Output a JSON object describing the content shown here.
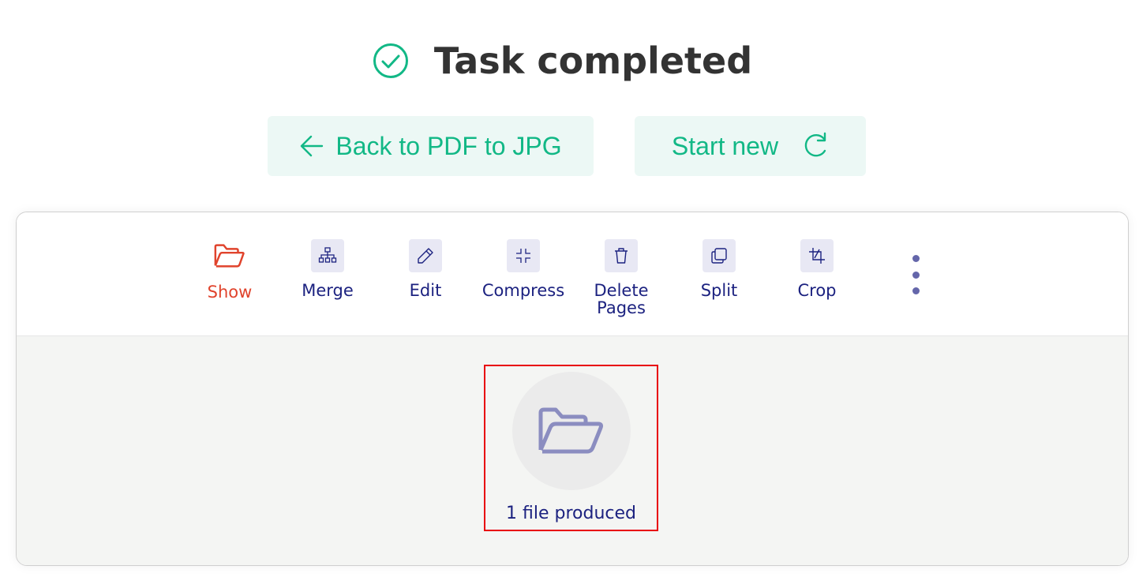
{
  "header": {
    "title": "Task completed",
    "status_icon": "check-circle-icon",
    "accent_color": "#12b886"
  },
  "actions": {
    "back_label": "Back to PDF to JPG",
    "back_icon": "arrow-left-icon",
    "new_label": "Start new",
    "new_icon": "refresh-icon"
  },
  "toolbar": {
    "items": [
      {
        "label": "Show",
        "icon": "folder-open-icon",
        "active": true
      },
      {
        "label": "Merge",
        "icon": "sitemap-icon"
      },
      {
        "label": "Edit",
        "icon": "pencil-icon"
      },
      {
        "label": "Compress",
        "icon": "compress-icon"
      },
      {
        "label": "Delete Pages",
        "icon": "trash-icon"
      },
      {
        "label": "Split",
        "icon": "copy-icon"
      },
      {
        "label": "Crop",
        "icon": "crop-icon"
      }
    ],
    "more_icon": "more-vertical-icon",
    "active_color": "#e0432c",
    "text_color": "#1c2280"
  },
  "result": {
    "icon": "folder-open-icon",
    "label": "1 file produced"
  }
}
